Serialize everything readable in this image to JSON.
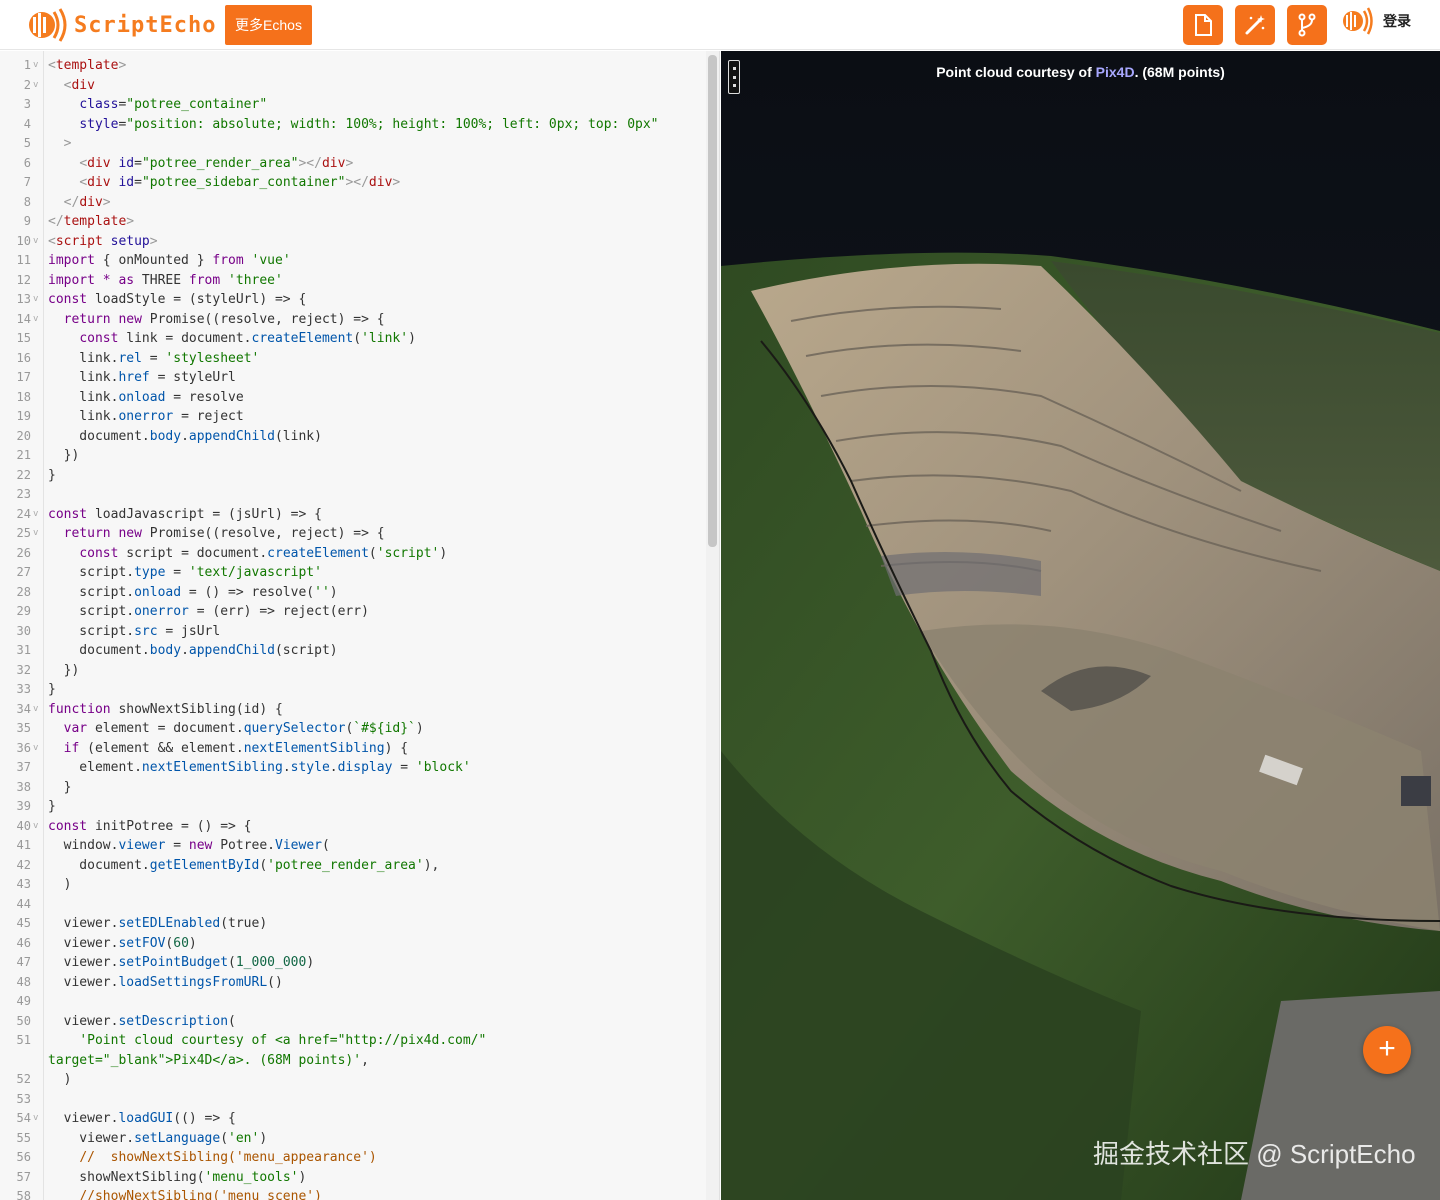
{
  "header": {
    "logo_text": "ScriptEcho",
    "more_button": "更多Echos",
    "tools": [
      "file-icon",
      "magic-wand-icon",
      "branch-icon"
    ],
    "login": "登录"
  },
  "viewer": {
    "description_prefix": "Point cloud courtesy of ",
    "description_link": "Pix4D",
    "description_suffix": ". (68M points)",
    "add_button": "+",
    "watermark": "掘金技术社区 @ ScriptEcho"
  },
  "colors": {
    "accent": "#f5711b",
    "link": "#a8a8ff"
  },
  "editor": {
    "line_numbers": [
      "1",
      "2",
      "3",
      "4",
      "5",
      "6",
      "7",
      "8",
      "9",
      "10",
      "11",
      "12",
      "13",
      "14",
      "15",
      "16",
      "17",
      "18",
      "19",
      "20",
      "21",
      "22",
      "23",
      "24",
      "25",
      "26",
      "27",
      "28",
      "29",
      "30",
      "31",
      "32",
      "33",
      "34",
      "35",
      "36",
      "37",
      "38",
      "39",
      "40",
      "41",
      "42",
      "43",
      "44",
      "45",
      "46",
      "47",
      "48",
      "49",
      "50",
      "51",
      "52",
      "53",
      "54",
      "55",
      "56",
      "57",
      "58"
    ],
    "lines": [
      [
        [
          "b",
          "<"
        ],
        [
          "t",
          "template"
        ],
        [
          "b",
          ">"
        ]
      ],
      [
        [
          "",
          "  "
        ],
        [
          "b",
          "<"
        ],
        [
          "t",
          "div"
        ]
      ],
      [
        [
          "",
          "    "
        ],
        [
          "a",
          "class"
        ],
        [
          "",
          "="
        ],
        [
          "s",
          "\"potree_container\""
        ]
      ],
      [
        [
          "",
          "    "
        ],
        [
          "a",
          "style"
        ],
        [
          "",
          "="
        ],
        [
          "s",
          "\"position: absolute; width: 100%; height: 100%; left: 0px; top: 0px\""
        ]
      ],
      [
        [
          "",
          "  "
        ],
        [
          "b",
          ">"
        ]
      ],
      [
        [
          "",
          "    "
        ],
        [
          "b",
          "<"
        ],
        [
          "t",
          "div"
        ],
        [
          "",
          " "
        ],
        [
          "a",
          "id"
        ],
        [
          "",
          "="
        ],
        [
          "s",
          "\"potree_render_area\""
        ],
        [
          "b",
          "></"
        ],
        [
          "t",
          "div"
        ],
        [
          "b",
          ">"
        ]
      ],
      [
        [
          "",
          "    "
        ],
        [
          "b",
          "<"
        ],
        [
          "t",
          "div"
        ],
        [
          "",
          " "
        ],
        [
          "a",
          "id"
        ],
        [
          "",
          "="
        ],
        [
          "s",
          "\"potree_sidebar_container\""
        ],
        [
          "b",
          "></"
        ],
        [
          "t",
          "div"
        ],
        [
          "b",
          ">"
        ]
      ],
      [
        [
          "",
          "  "
        ],
        [
          "b",
          "</"
        ],
        [
          "t",
          "div"
        ],
        [
          "b",
          ">"
        ]
      ],
      [
        [
          "b",
          "</"
        ],
        [
          "t",
          "template"
        ],
        [
          "b",
          ">"
        ]
      ],
      [
        [
          "b",
          "<"
        ],
        [
          "t",
          "script"
        ],
        [
          "",
          " "
        ],
        [
          "a",
          "setup"
        ],
        [
          "b",
          ">"
        ]
      ],
      [
        [
          "k",
          "import"
        ],
        [
          "",
          " { onMounted } "
        ],
        [
          "k",
          "from"
        ],
        [
          "",
          " "
        ],
        [
          "s",
          "'vue'"
        ]
      ],
      [
        [
          "k",
          "import"
        ],
        [
          "",
          " "
        ],
        [
          "k",
          "*"
        ],
        [
          "",
          " "
        ],
        [
          "k",
          "as"
        ],
        [
          "",
          " THREE "
        ],
        [
          "k",
          "from"
        ],
        [
          "",
          " "
        ],
        [
          "s",
          "'three'"
        ]
      ],
      [
        [
          "k",
          "const"
        ],
        [
          "",
          " loadStyle = (styleUrl) => {"
        ]
      ],
      [
        [
          "",
          "  "
        ],
        [
          "k",
          "return"
        ],
        [
          "",
          " "
        ],
        [
          "k",
          "new"
        ],
        [
          "",
          " Promise((resolve, reject) => {"
        ]
      ],
      [
        [
          "",
          "    "
        ],
        [
          "k",
          "const"
        ],
        [
          "",
          " link = document."
        ],
        [
          "p",
          "createElement"
        ],
        [
          "",
          "("
        ],
        [
          "s",
          "'link'"
        ],
        [
          "",
          ")"
        ]
      ],
      [
        [
          "",
          "    link."
        ],
        [
          "p",
          "rel"
        ],
        [
          "",
          " = "
        ],
        [
          "s",
          "'stylesheet'"
        ]
      ],
      [
        [
          "",
          "    link."
        ],
        [
          "p",
          "href"
        ],
        [
          "",
          " = styleUrl"
        ]
      ],
      [
        [
          "",
          "    link."
        ],
        [
          "p",
          "onload"
        ],
        [
          "",
          " = resolve"
        ]
      ],
      [
        [
          "",
          "    link."
        ],
        [
          "p",
          "onerror"
        ],
        [
          "",
          " = reject"
        ]
      ],
      [
        [
          "",
          "    document."
        ],
        [
          "p",
          "body"
        ],
        [
          "",
          "."
        ],
        [
          "p",
          "appendChild"
        ],
        [
          "",
          "(link)"
        ]
      ],
      [
        [
          "",
          "  })"
        ]
      ],
      [
        [
          "",
          "}"
        ]
      ],
      [
        [
          "",
          ""
        ]
      ],
      [
        [
          "k",
          "const"
        ],
        [
          "",
          " loadJavascript = (jsUrl) => {"
        ]
      ],
      [
        [
          "",
          "  "
        ],
        [
          "k",
          "return"
        ],
        [
          "",
          " "
        ],
        [
          "k",
          "new"
        ],
        [
          "",
          " Promise((resolve, reject) => {"
        ]
      ],
      [
        [
          "",
          "    "
        ],
        [
          "k",
          "const"
        ],
        [
          "",
          " script = document."
        ],
        [
          "p",
          "createElement"
        ],
        [
          "",
          "("
        ],
        [
          "s",
          "'script'"
        ],
        [
          "",
          ")"
        ]
      ],
      [
        [
          "",
          "    script."
        ],
        [
          "p",
          "type"
        ],
        [
          "",
          " = "
        ],
        [
          "s",
          "'text/javascript'"
        ]
      ],
      [
        [
          "",
          "    script."
        ],
        [
          "p",
          "onload"
        ],
        [
          "",
          " = () => resolve("
        ],
        [
          "s",
          "''"
        ],
        [
          "",
          ")"
        ]
      ],
      [
        [
          "",
          "    script."
        ],
        [
          "p",
          "onerror"
        ],
        [
          "",
          " = (err) => reject(err)"
        ]
      ],
      [
        [
          "",
          "    script."
        ],
        [
          "p",
          "src"
        ],
        [
          "",
          " = jsUrl"
        ]
      ],
      [
        [
          "",
          "    document."
        ],
        [
          "p",
          "body"
        ],
        [
          "",
          "."
        ],
        [
          "p",
          "appendChild"
        ],
        [
          "",
          "(script)"
        ]
      ],
      [
        [
          "",
          "  })"
        ]
      ],
      [
        [
          "",
          "}"
        ]
      ],
      [
        [
          "k",
          "function"
        ],
        [
          "",
          " showNextSibling(id) {"
        ]
      ],
      [
        [
          "",
          "  "
        ],
        [
          "k",
          "var"
        ],
        [
          "",
          " element = document."
        ],
        [
          "p",
          "querySelector"
        ],
        [
          "",
          "("
        ],
        [
          "s",
          "`#${id}`"
        ],
        [
          "",
          ")"
        ]
      ],
      [
        [
          "",
          "  "
        ],
        [
          "k",
          "if"
        ],
        [
          "",
          " (element && element."
        ],
        [
          "p",
          "nextElementSibling"
        ],
        [
          "",
          ") {"
        ]
      ],
      [
        [
          "",
          "    element."
        ],
        [
          "p",
          "nextElementSibling"
        ],
        [
          "",
          "."
        ],
        [
          "p",
          "style"
        ],
        [
          "",
          "."
        ],
        [
          "p",
          "display"
        ],
        [
          "",
          " = "
        ],
        [
          "s",
          "'block'"
        ]
      ],
      [
        [
          "",
          "  }"
        ]
      ],
      [
        [
          "",
          "}"
        ]
      ],
      [
        [
          "k",
          "const"
        ],
        [
          "",
          " initPotree = () => {"
        ]
      ],
      [
        [
          "",
          "  window."
        ],
        [
          "p",
          "viewer"
        ],
        [
          "",
          " = "
        ],
        [
          "k",
          "new"
        ],
        [
          "",
          " Potree."
        ],
        [
          "p",
          "Viewer"
        ],
        [
          "",
          "("
        ]
      ],
      [
        [
          "",
          "    document."
        ],
        [
          "p",
          "getElementById"
        ],
        [
          "",
          "("
        ],
        [
          "s",
          "'potree_render_area'"
        ],
        [
          "",
          "),"
        ]
      ],
      [
        [
          "",
          "  )"
        ]
      ],
      [
        [
          "",
          ""
        ]
      ],
      [
        [
          "",
          "  viewer."
        ],
        [
          "p",
          "setEDLEnabled"
        ],
        [
          "",
          "(true)"
        ]
      ],
      [
        [
          "",
          "  viewer."
        ],
        [
          "p",
          "setFOV"
        ],
        [
          "",
          "("
        ],
        [
          "n",
          "60"
        ],
        [
          "",
          ")"
        ]
      ],
      [
        [
          "",
          "  viewer."
        ],
        [
          "p",
          "setPointBudget"
        ],
        [
          "",
          "("
        ],
        [
          "n",
          "1_000_000"
        ],
        [
          "",
          ")"
        ]
      ],
      [
        [
          "",
          "  viewer."
        ],
        [
          "p",
          "loadSettingsFromURL"
        ],
        [
          "",
          "()"
        ]
      ],
      [
        [
          "",
          ""
        ]
      ],
      [
        [
          "",
          "  viewer."
        ],
        [
          "p",
          "setDescription"
        ],
        [
          "",
          "("
        ]
      ],
      [
        [
          "",
          "    "
        ],
        [
          "s",
          "'Point cloud courtesy of <a href=\"http://pix4d.com/\"\ntarget=\"_blank\">Pix4D</a>. (68M points)'"
        ],
        [
          "",
          ","
        ]
      ],
      [
        [
          "",
          "  )"
        ]
      ],
      [
        [
          "",
          ""
        ]
      ],
      [
        [
          "",
          "  viewer."
        ],
        [
          "p",
          "loadGUI"
        ],
        [
          "",
          "(() => {"
        ]
      ],
      [
        [
          "",
          "    viewer."
        ],
        [
          "p",
          "setLanguage"
        ],
        [
          "",
          "("
        ],
        [
          "s",
          "'en'"
        ],
        [
          "",
          ")"
        ]
      ],
      [
        [
          "",
          "    "
        ],
        [
          "c",
          "//  showNextSibling('menu_appearance')"
        ]
      ],
      [
        [
          "",
          "    showNextSibling("
        ],
        [
          "s",
          "'menu_tools'"
        ],
        [
          "",
          ")"
        ]
      ],
      [
        [
          "",
          "    "
        ],
        [
          "c",
          "//showNextSibling('menu_scene')"
        ]
      ]
    ],
    "foldable": [
      "1",
      "2",
      "10",
      "13",
      "14",
      "24",
      "25",
      "34",
      "36",
      "40",
      "54"
    ]
  }
}
